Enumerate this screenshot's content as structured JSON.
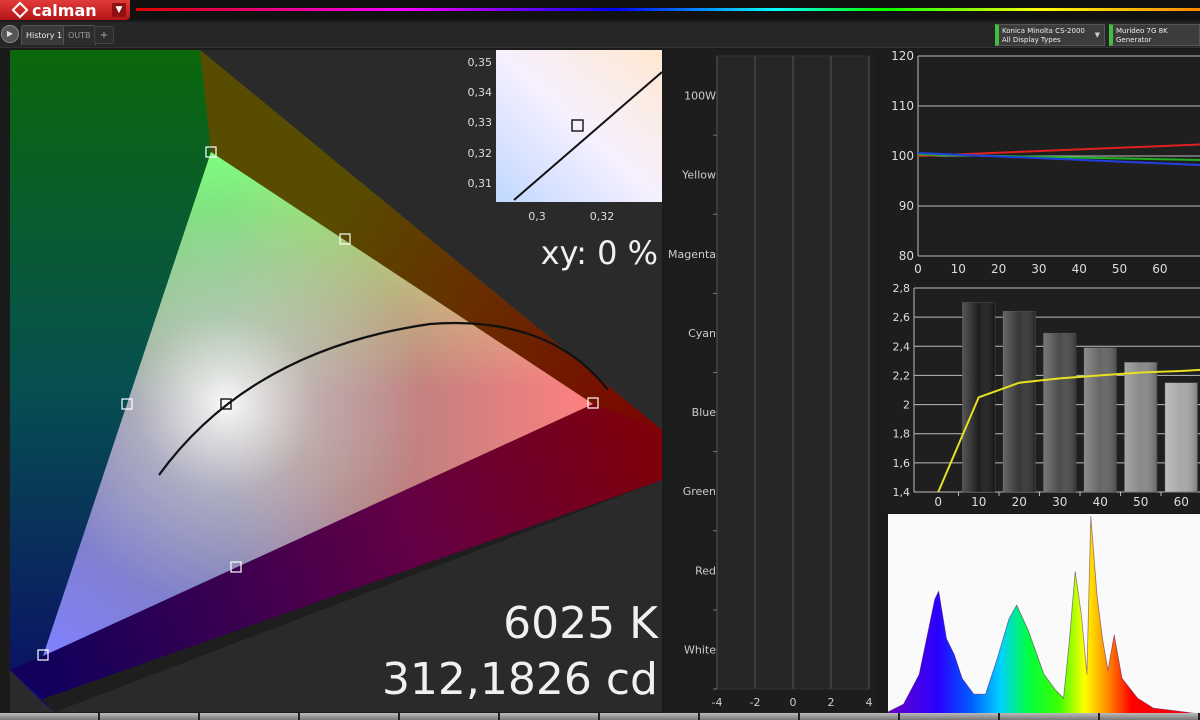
{
  "app": {
    "logo_text": "calman",
    "colors": {
      "accent": "#d42a2a",
      "panel_bg": "#1d1d1d",
      "chart_bg": "#2a2a2a"
    }
  },
  "tabs": [
    {
      "label": "History 1",
      "active": true
    },
    {
      "label": "OUTB",
      "active": false
    }
  ],
  "tab_add_label": "+",
  "play_icon": "play-icon",
  "devices": [
    {
      "line1": "Konica Minolta CS-2000",
      "line2": "All Display Types"
    },
    {
      "line1": "Murideo 7G 8K Generator",
      "line2": ""
    }
  ],
  "cie": {
    "xy_label": "xy: 0 %",
    "cct_label": "6025 K",
    "luminance_label": "312,1826 cd",
    "inset_y_ticks": [
      "0,35",
      "0,34",
      "0,33",
      "0,32",
      "0,31"
    ],
    "inset_x_ticks": [
      "0,3",
      "0,32"
    ]
  },
  "chart_data": [
    {
      "type": "bar",
      "categories": [
        "100W",
        "Yellow",
        "Magenta",
        "Cyan",
        "Blue",
        "Green",
        "Red",
        "White"
      ],
      "x_ticks": [
        "-4",
        "-2",
        "0",
        "2",
        "4"
      ],
      "xlim": [
        -4,
        4
      ],
      "values": [
        0,
        0,
        0,
        0,
        0,
        0,
        0,
        0
      ]
    },
    {
      "type": "line",
      "x_ticks": [
        "0",
        "10",
        "20",
        "30",
        "40",
        "50",
        "60"
      ],
      "y_ticks": [
        "120",
        "110",
        "100",
        "90",
        "80"
      ],
      "ylim": [
        80,
        120
      ],
      "series": [
        {
          "color": "#e02020",
          "x": [
            0,
            70
          ],
          "y": [
            100,
            102.3
          ]
        },
        {
          "color": "#20b020",
          "x": [
            0,
            70
          ],
          "y": [
            100.3,
            99.2
          ]
        },
        {
          "color": "#2040e0",
          "x": [
            0,
            70
          ],
          "y": [
            100.6,
            98.2
          ]
        }
      ]
    },
    {
      "type": "bar",
      "categories": [
        "0",
        "10",
        "20",
        "30",
        "40",
        "50",
        "60"
      ],
      "y_ticks": [
        "2,8",
        "2,6",
        "2,4",
        "2,2",
        "2",
        "1,8",
        "1,6",
        "1,4"
      ],
      "ylim": [
        1.4,
        2.8
      ],
      "values": [
        null,
        2.7,
        2.64,
        2.49,
        2.39,
        2.29,
        2.15
      ],
      "target_line": {
        "color": "#e8e020",
        "x": [
          0,
          10,
          20,
          30,
          40,
          50,
          60,
          66
        ],
        "y": [
          1.4,
          2.05,
          2.15,
          2.18,
          2.2,
          2.22,
          2.23,
          2.24
        ]
      }
    },
    {
      "type": "area",
      "description_free": true,
      "x": [
        380,
        400,
        420,
        440,
        445,
        455,
        465,
        475,
        490,
        505,
        520,
        535,
        545,
        560,
        580,
        595,
        605,
        612,
        620,
        628,
        635,
        640,
        648,
        655,
        662,
        670,
        680,
        700,
        720,
        740,
        760,
        780
      ],
      "y": [
        0.01,
        0.05,
        0.2,
        0.58,
        0.62,
        0.38,
        0.3,
        0.18,
        0.1,
        0.1,
        0.28,
        0.48,
        0.55,
        0.42,
        0.2,
        0.12,
        0.08,
        0.35,
        0.72,
        0.5,
        0.2,
        1.0,
        0.6,
        0.38,
        0.22,
        0.4,
        0.18,
        0.08,
        0.03,
        0.02,
        0.01,
        0.0
      ]
    }
  ]
}
